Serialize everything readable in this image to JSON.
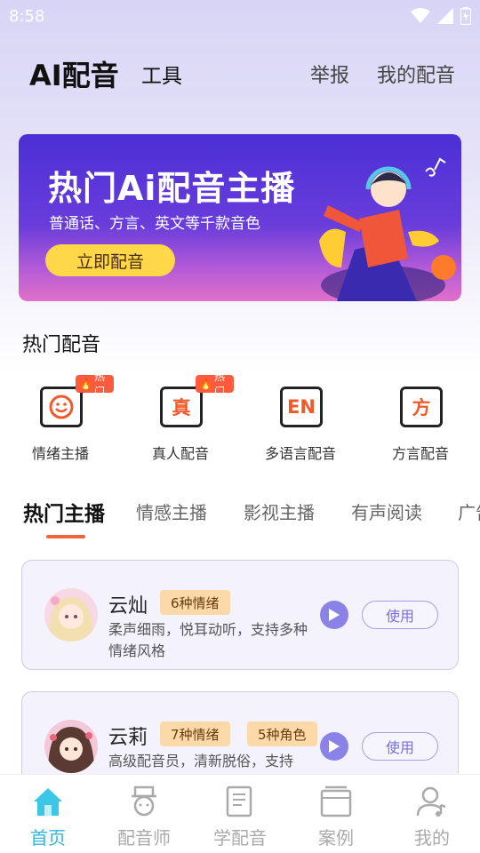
{
  "status_bar": {
    "time": "8:58"
  },
  "header": {
    "app_title": "AI配音",
    "tool_tab": "工具",
    "report_link": "举报",
    "my_dub_link": "我的配音"
  },
  "banner": {
    "title": "热门Ai配音主播",
    "subtitle": "普通话、方言、英文等千款音色",
    "button_label": "立即配音"
  },
  "hot_section": {
    "title": "热门配音",
    "items": [
      {
        "label": "情绪主播",
        "icon": "smiley-icon",
        "icon_text": "☺",
        "badge": "热门"
      },
      {
        "label": "真人配音",
        "icon": "zhen-icon",
        "icon_text": "真",
        "badge": "热门"
      },
      {
        "label": "多语言配音",
        "icon": "en-icon",
        "icon_text": "EN",
        "badge": ""
      },
      {
        "label": "方言配音",
        "icon": "fang-icon",
        "icon_text": "方",
        "badge": ""
      }
    ]
  },
  "tabs": [
    {
      "label": "热门主播",
      "active": true
    },
    {
      "label": "情感主播",
      "active": false
    },
    {
      "label": "影视主播",
      "active": false
    },
    {
      "label": "有声阅读",
      "active": false
    },
    {
      "label": "广告",
      "active": false
    }
  ],
  "anchors": [
    {
      "name": "云灿",
      "tags": [
        "6种情绪"
      ],
      "description": "柔声细雨，悦耳动听，支持多种情绪风格",
      "use_label": "使用"
    },
    {
      "name": "云莉",
      "tags": [
        "7种情绪",
        "5种角色"
      ],
      "description": "高级配音员，清新脱俗，支持",
      "use_label": "使用"
    }
  ],
  "bottom_nav": [
    {
      "label": "首页",
      "icon": "home-icon",
      "active": true
    },
    {
      "label": "配音师",
      "icon": "voice-actor-icon",
      "active": false
    },
    {
      "label": "学配音",
      "icon": "book-icon",
      "active": false
    },
    {
      "label": "案例",
      "icon": "cases-icon",
      "active": false
    },
    {
      "label": "我的",
      "icon": "profile-icon",
      "active": false
    }
  ],
  "colors": {
    "accent": "#f0643a",
    "brand_purple": "#8b82e8",
    "nav_active": "#33b7dd",
    "banner_button": "#ffd84a"
  }
}
